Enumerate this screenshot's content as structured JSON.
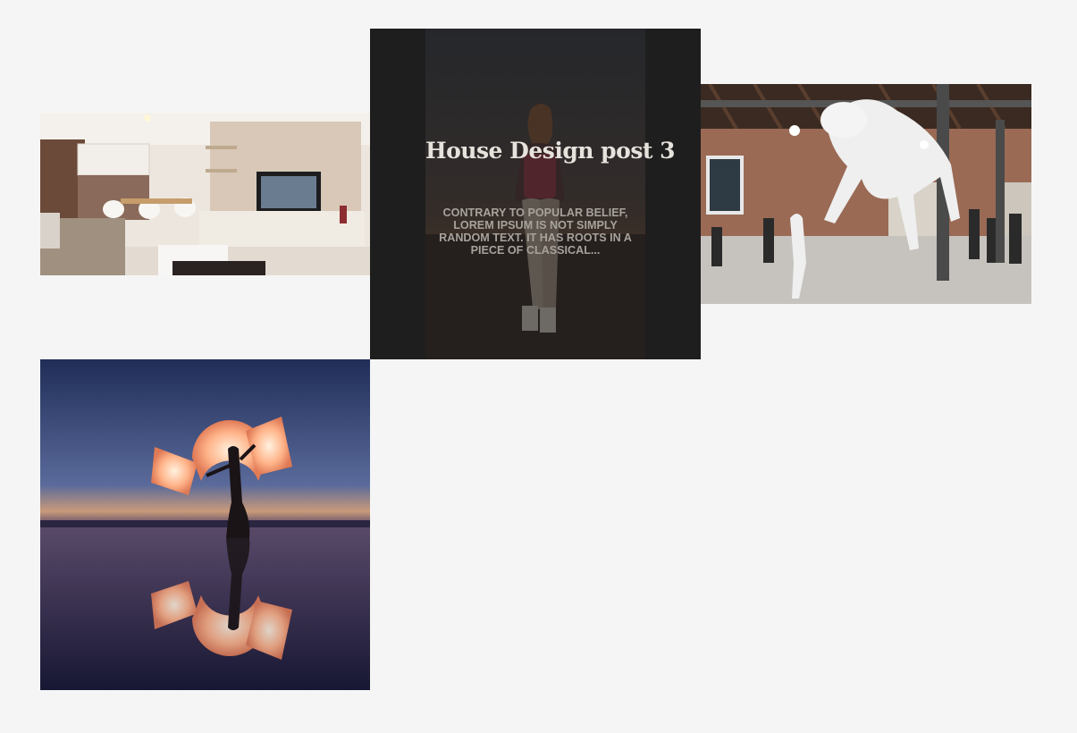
{
  "posts": [
    {
      "id": 1,
      "image": "interior-living-room-photo"
    },
    {
      "id": 3,
      "image": "woman-walking-at-dusk-photo",
      "hovered": true,
      "title": "House Design post 3",
      "excerpt": "Contrary to popular belief, Lorem Ipsum is not simply random text. It has roots in a piece of classical..."
    },
    {
      "id": 2,
      "image": "white-horse-sculpture-gallery-photo"
    },
    {
      "id": 4,
      "image": "light-painting-on-beach-photo"
    }
  ],
  "colors": {
    "page_background": "#f5f5f5",
    "hover_tile_background": "#2a2a2a",
    "title_text": "#e6e2dc",
    "excerpt_text": "#a7a29b"
  }
}
